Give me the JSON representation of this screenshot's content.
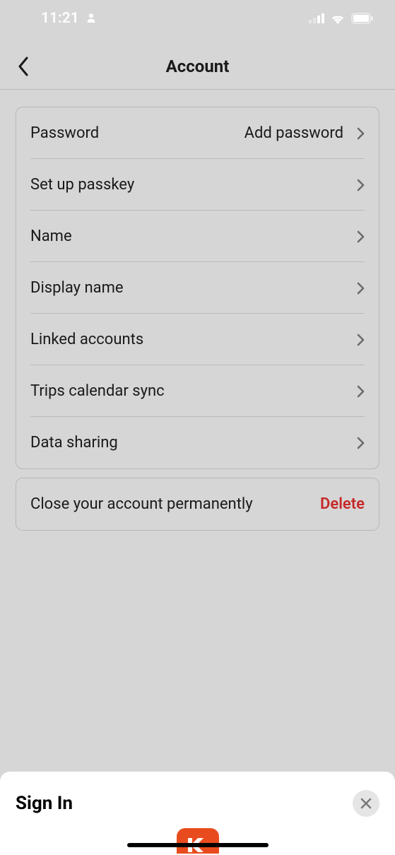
{
  "statusBar": {
    "time": "11:21"
  },
  "header": {
    "title": "Account"
  },
  "settings": {
    "rows": [
      {
        "label": "Password",
        "value": "Add password"
      },
      {
        "label": "Set up passkey",
        "value": ""
      },
      {
        "label": "Name",
        "value": ""
      },
      {
        "label": "Display name",
        "value": ""
      },
      {
        "label": "Linked accounts",
        "value": ""
      },
      {
        "label": "Trips calendar sync",
        "value": ""
      },
      {
        "label": "Data sharing",
        "value": ""
      }
    ]
  },
  "deleteSection": {
    "label": "Close your account permanently",
    "action": "Delete"
  },
  "bottomSheet": {
    "title": "Sign In"
  }
}
